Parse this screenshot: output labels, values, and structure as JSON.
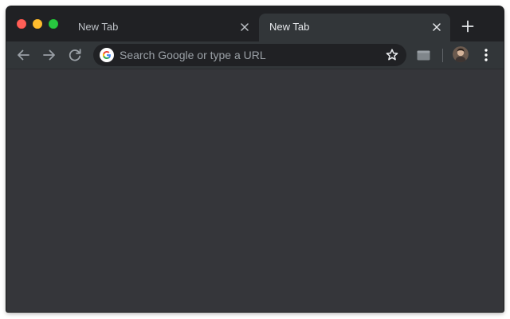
{
  "window": {
    "controls": {
      "close_color": "#ff5f57",
      "minimize_color": "#febc2e",
      "zoom_color": "#28c840"
    }
  },
  "tabs": [
    {
      "title": "New Tab",
      "active": false,
      "close_icon": "close-icon"
    },
    {
      "title": "New Tab",
      "active": true,
      "close_icon": "close-icon"
    }
  ],
  "new_tab_icon": "plus-icon",
  "toolbar": {
    "back_icon": "arrow-left-icon",
    "forward_icon": "arrow-right-icon",
    "reload_icon": "reload-icon",
    "omnibox": {
      "placeholder": "Search Google or type a URL",
      "value": "",
      "leading_icon": "google-g-icon",
      "bookmark_icon": "star-outline-icon"
    },
    "extension_icon": "extension-card-icon",
    "profile_icon": "avatar",
    "menu_icon": "kebab-menu-icon"
  },
  "theme": {
    "titlebar": "#202124",
    "toolbar": "#323639",
    "omnibox": "#202124",
    "content": "#35363a",
    "text_active": "#e8eaed",
    "text_inactive": "#bdc1c6",
    "placeholder": "#9aa0a6"
  }
}
